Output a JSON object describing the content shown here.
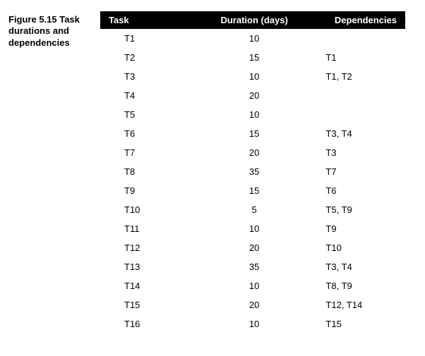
{
  "caption": "Figure 5.15 Task durations and dependencies",
  "headers": {
    "task": "Task",
    "duration": "Duration (days)",
    "dependencies": "Dependencies"
  },
  "rows": [
    {
      "task": "T1",
      "duration": "10",
      "dependencies": ""
    },
    {
      "task": "T2",
      "duration": "15",
      "dependencies": "T1"
    },
    {
      "task": "T3",
      "duration": "10",
      "dependencies": "T1, T2"
    },
    {
      "task": "T4",
      "duration": "20",
      "dependencies": ""
    },
    {
      "task": "T5",
      "duration": "10",
      "dependencies": ""
    },
    {
      "task": "T6",
      "duration": "15",
      "dependencies": "T3, T4"
    },
    {
      "task": "T7",
      "duration": "20",
      "dependencies": "T3"
    },
    {
      "task": "T8",
      "duration": "35",
      "dependencies": "T7"
    },
    {
      "task": "T9",
      "duration": "15",
      "dependencies": "T6"
    },
    {
      "task": "T10",
      "duration": "5",
      "dependencies": "T5, T9"
    },
    {
      "task": "T11",
      "duration": "10",
      "dependencies": "T9"
    },
    {
      "task": "T12",
      "duration": "20",
      "dependencies": "T10"
    },
    {
      "task": "T13",
      "duration": "35",
      "dependencies": "T3, T4"
    },
    {
      "task": "T14",
      "duration": "10",
      "dependencies": "T8, T9"
    },
    {
      "task": "T15",
      "duration": "20",
      "dependencies": "T12, T14"
    },
    {
      "task": "T16",
      "duration": "10",
      "dependencies": "T15"
    }
  ]
}
